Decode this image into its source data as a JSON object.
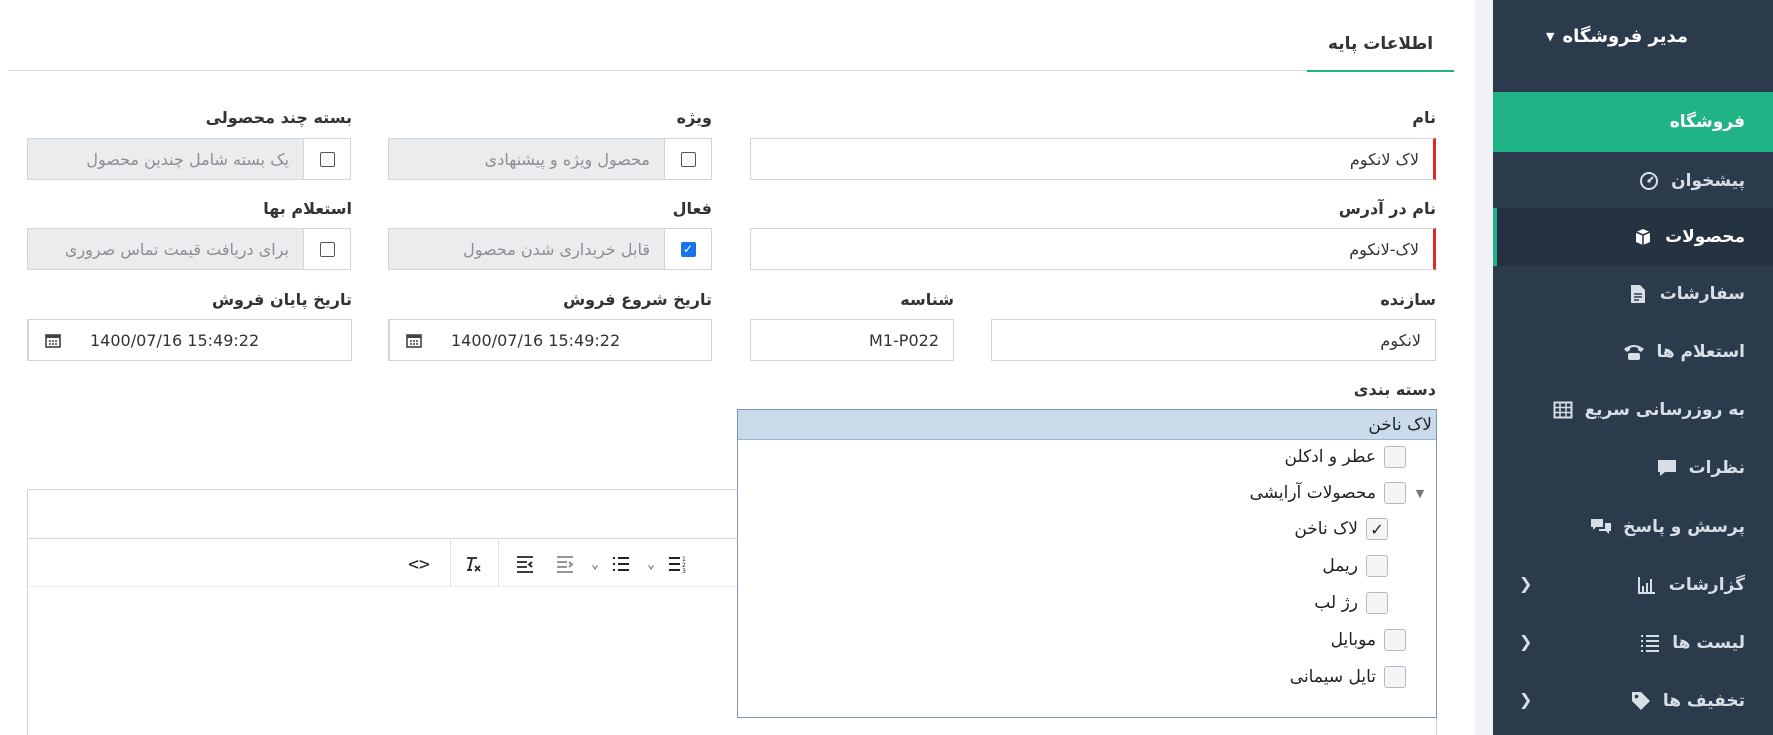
{
  "sidebar": {
    "header": "مدیر فروشگاه",
    "items": [
      {
        "label": "فروشگاه",
        "icon": "none"
      },
      {
        "label": "پیشخوان",
        "icon": "dashboard-icon"
      },
      {
        "label": "محصولات",
        "icon": "box-icon"
      },
      {
        "label": "سفارشات",
        "icon": "document-icon"
      },
      {
        "label": "استعلام ها",
        "icon": "phone-icon"
      },
      {
        "label": "به روزرسانی سریع",
        "icon": "table-icon"
      },
      {
        "label": "نظرات",
        "icon": "comment-icon"
      },
      {
        "label": "پرسش و پاسخ",
        "icon": "chat-icon"
      },
      {
        "label": "گزارشات",
        "icon": "chart-icon"
      },
      {
        "label": "لیست ها",
        "icon": "list-icon"
      },
      {
        "label": "تخفیف ها",
        "icon": "tag-icon"
      }
    ]
  },
  "tabs": [
    {
      "label": "اطلاعات پایه"
    }
  ],
  "form": {
    "name": {
      "label": "نام",
      "value": "لاک لانکوم"
    },
    "special": {
      "label": "ویژه",
      "placeholder": "محصول ویژه و پیشنهادی",
      "checked": false
    },
    "bundle": {
      "label": "بسته چند محصولی",
      "placeholder": "یک بسته شامل چندین محصول",
      "checked": false
    },
    "slug": {
      "label": "نام در آدرس",
      "value": "لاک-لانکوم"
    },
    "active": {
      "label": "فعال",
      "placeholder": "قابل خریداری شدن محصول",
      "checked": true
    },
    "inquiry": {
      "label": "استعلام بها",
      "placeholder": "برای دریافت قیمت تماس صروری",
      "checked": false
    },
    "manufacturer": {
      "label": "سازنده",
      "value": "لانکوم"
    },
    "sku": {
      "label": "شناسه",
      "value": "M1-P022"
    },
    "sale_start": {
      "label": "تاریخ شروع فروش",
      "value": "1400/07/16  15:49:22"
    },
    "sale_end": {
      "label": "تاریخ پایان فروش",
      "value": "1400/07/16  15:49:22"
    },
    "category": {
      "label": "دسته بندی",
      "selected": "لاک ناخن",
      "nodes": [
        {
          "label": "عطر و ادکلن",
          "checked": false,
          "level": 0
        },
        {
          "label": "محصولات آرایشی",
          "checked": false,
          "level": 0,
          "expanded": true
        },
        {
          "label": "لاک ناخن",
          "checked": true,
          "level": 1
        },
        {
          "label": "ریمل",
          "checked": false,
          "level": 1
        },
        {
          "label": "رژ لب",
          "checked": false,
          "level": 1
        },
        {
          "label": "موبایل",
          "checked": false,
          "level": 0
        },
        {
          "label": "تایل سیمانی",
          "checked": false,
          "level": 0
        }
      ]
    }
  },
  "editor": {
    "toolbar": [
      "source-code-icon",
      "clear-format-icon",
      "align-right-icon",
      "align-left-icon",
      "bullet-list-icon",
      "numbered-list-icon"
    ]
  },
  "colors": {
    "sidebar": "#2c3b4c",
    "accent": "#20b386",
    "required": "#e02a2a"
  }
}
